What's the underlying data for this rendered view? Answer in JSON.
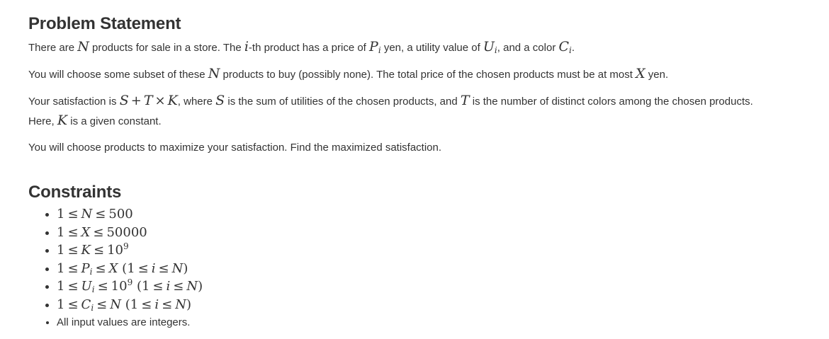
{
  "problem_statement": {
    "title": "Problem Statement",
    "p1": {
      "t1": "There are ",
      "t2": " products for sale in a store. The ",
      "t3": "-th product has a price of ",
      "t4": " yen, a utility value of ",
      "t5": ", and a color ",
      "t6": "."
    },
    "p2": {
      "t1": "You will choose some subset of these ",
      "t2": " products to buy (possibly none). The total price of the chosen products must be at most ",
      "t3": " yen."
    },
    "p3": {
      "t1": "Your satisfaction is ",
      "t2": ", where ",
      "t3": " is the sum of utilities of the chosen products, and ",
      "t4": " is the number of distinct colors among the chosen products.",
      "t5": "Here, ",
      "t6": " is a given constant."
    },
    "p4": "You will choose products to maximize your satisfaction. Find the maximized satisfaction."
  },
  "constraints": {
    "title": "Constraints",
    "last_item": "All input values are integers."
  },
  "math": {
    "N": "N",
    "i": "i",
    "P": "P",
    "U": "U",
    "C": "C",
    "X": "X",
    "S": "S",
    "T": "T",
    "K": "K",
    "plus": "+",
    "times": "×",
    "one": "1",
    "le": "≤",
    "n500": "500",
    "n50000": "50000",
    "ten": "10",
    "nine": "9",
    "lparen": "(",
    "rparen": ")"
  }
}
